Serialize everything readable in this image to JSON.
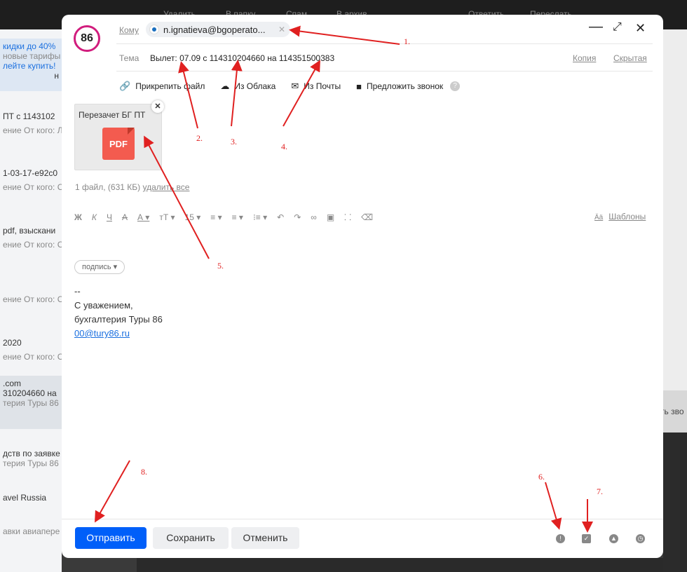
{
  "background": {
    "topbar": [
      "Удалить",
      "В папку",
      "Спам",
      "В архив",
      "Ответить",
      "Переслать"
    ],
    "left_list": [
      {
        "title": "кидки до 40%",
        "sub": "новые тарифы"
      },
      {
        "title": "лейте купить!",
        "sub": "н"
      },
      {
        "title": "ПТ с 1143102",
        "sub": "ение От кого: Л"
      },
      {
        "title": "1-03-17-e92c0",
        "sub": "ение От кого: C"
      },
      {
        "title": "pdf, взыскани",
        "sub": "ение От кого: C"
      },
      {
        "title": "",
        "sub": "ение От кого: C"
      },
      {
        "title": " 2020",
        "sub": "ение От кого: C"
      },
      {
        "title": ".com",
        "sub": "310204660 на"
      },
      {
        "title": "",
        "sub": "терия Туры 86"
      },
      {
        "title": "дств по заявке",
        "sub": "терия Туры 86"
      },
      {
        "title": "avel Russia",
        "sub": ""
      },
      {
        "title": "авки авиапере",
        "sub": ""
      }
    ],
    "right_hint": "ть зво"
  },
  "compose": {
    "avatar_text": "86",
    "to_label": "Кому",
    "recipient": "n.ignatieva@bgoperato...",
    "subject_label": "Тема",
    "subject": "Вылет: 07.09 с 114310204660 на 114351500383",
    "cc_label": "Копия",
    "bcc_label": "Скрытая",
    "window": {
      "minimize": "—",
      "expand": "⤢",
      "close": "✕"
    },
    "attach_actions": [
      "Прикрепить файл",
      "Из Облака",
      "Из Почты",
      "Предложить звонок"
    ],
    "attachment": {
      "name": "Перезачет БГ ПТ",
      "type": "PDF"
    },
    "file_info_prefix": "1 файл, (631 КБ)",
    "file_info_link": "удалить все",
    "format_tools": [
      "Ж",
      "К",
      "Ч",
      "А",
      "А ▾",
      "тТ ▾",
      "15 ▾",
      "≡ ▾",
      "≡ ▾",
      "⁝≡ ▾",
      "↶",
      "↷",
      "∞",
      "▣",
      "⸬",
      "⌫"
    ],
    "templates_label": "Шаблоны",
    "signature_pill": "подпись ▾",
    "body_lines": [
      "--",
      "С уважением,",
      "бухгалтерия Туры 86"
    ],
    "body_link": "00@tury86.ru",
    "buttons": {
      "send": "Отправить",
      "save": "Сохранить",
      "cancel": "Отменить"
    }
  },
  "annotations": {
    "labels": [
      "1.",
      "2.",
      "3.",
      "4.",
      "5.",
      "6.",
      "7.",
      "8."
    ],
    "color": "#e02020"
  },
  "colors": {
    "accent": "#005ff9",
    "avatar_ring": "#d11c7d",
    "pdf": "#f35b4f",
    "annotation": "#e02020"
  }
}
